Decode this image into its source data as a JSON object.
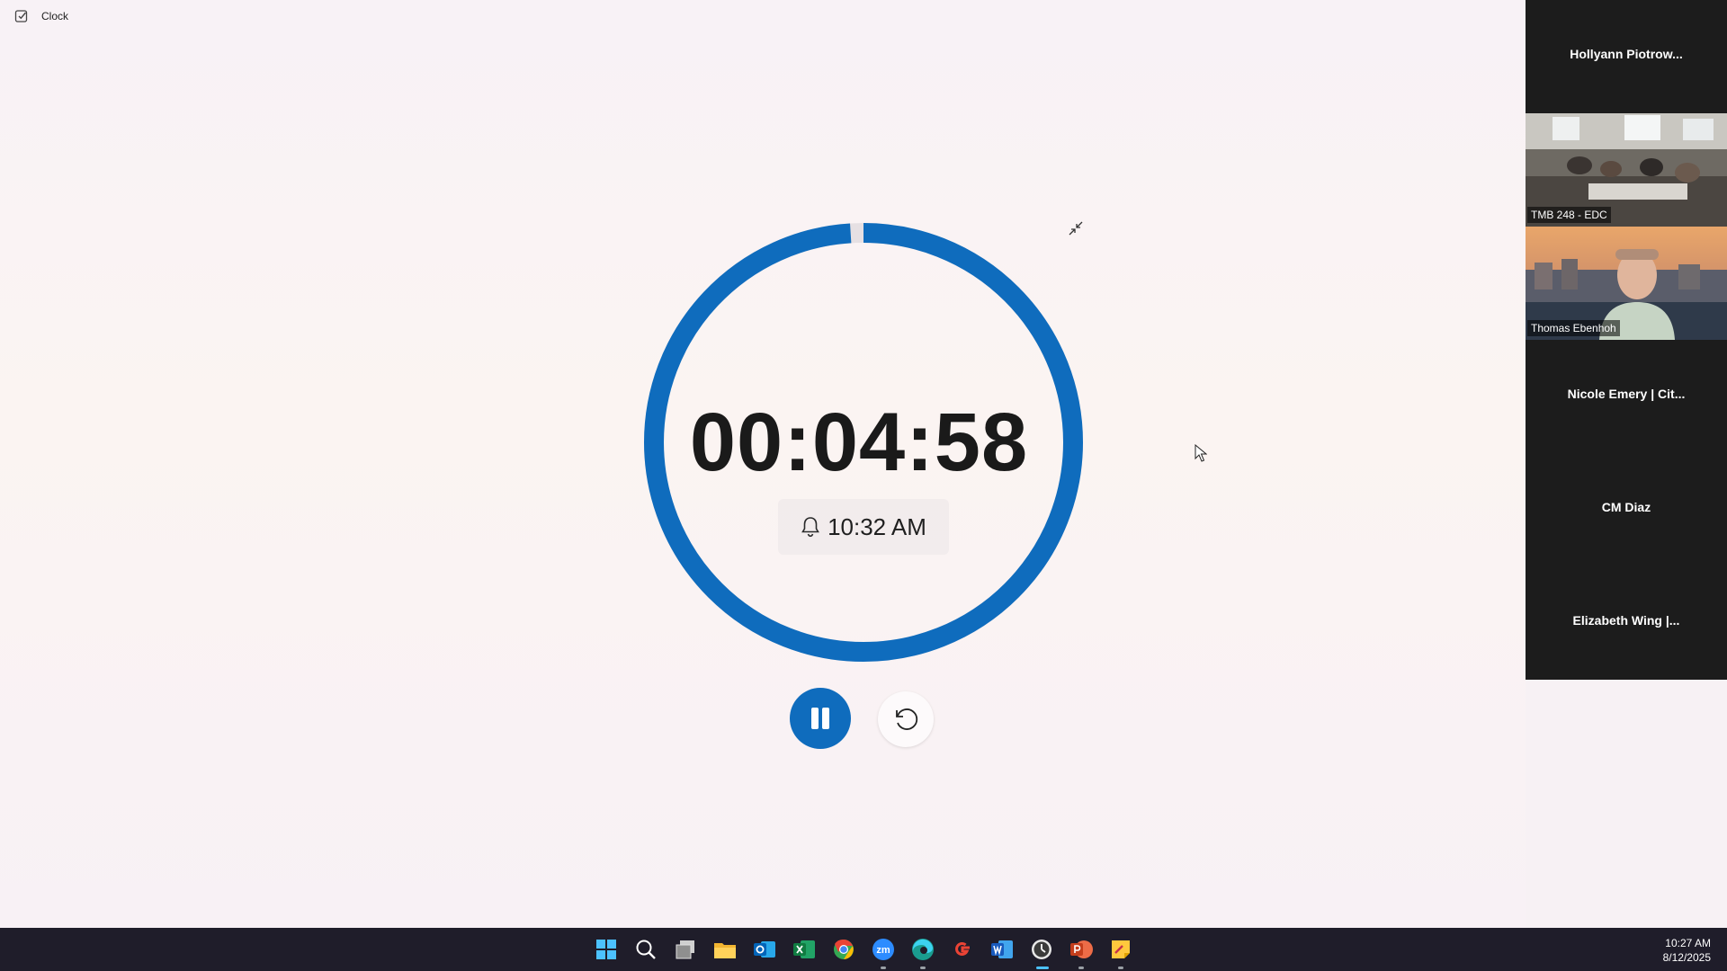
{
  "app": {
    "title": "Clock",
    "icon": "clock-app-icon"
  },
  "timer": {
    "remaining": "00:04:58",
    "alarm_time": "10:32 AM",
    "progress": 0.99,
    "accent": "#0f6cbd",
    "buttons": {
      "pause": "pause-icon",
      "reset": "reset-icon",
      "compact": "compact-overlay-icon"
    }
  },
  "meeting": {
    "participants": [
      {
        "name": "Hollyann  Piotrow...",
        "video": false
      },
      {
        "name": "TMB 248 - EDC",
        "video": true
      },
      {
        "name": "Thomas Ebenhoh",
        "video": true
      },
      {
        "name": "Nicole Emery | Cit...",
        "video": false
      },
      {
        "name": "CM Diaz",
        "video": false
      },
      {
        "name": "Elizabeth Wing |...",
        "video": false
      }
    ]
  },
  "taskbar": {
    "icons": [
      "windows-start-icon",
      "search-icon",
      "task-view-icon",
      "file-explorer-icon",
      "outlook-icon",
      "excel-icon",
      "chrome-icon",
      "zoom-icon",
      "edge-icon",
      "google-icon",
      "word-icon",
      "clock-icon",
      "powerpoint-icon",
      "sticky-notes-icon"
    ],
    "clock": {
      "time": "10:27 AM",
      "date": "8/12/2025"
    }
  }
}
